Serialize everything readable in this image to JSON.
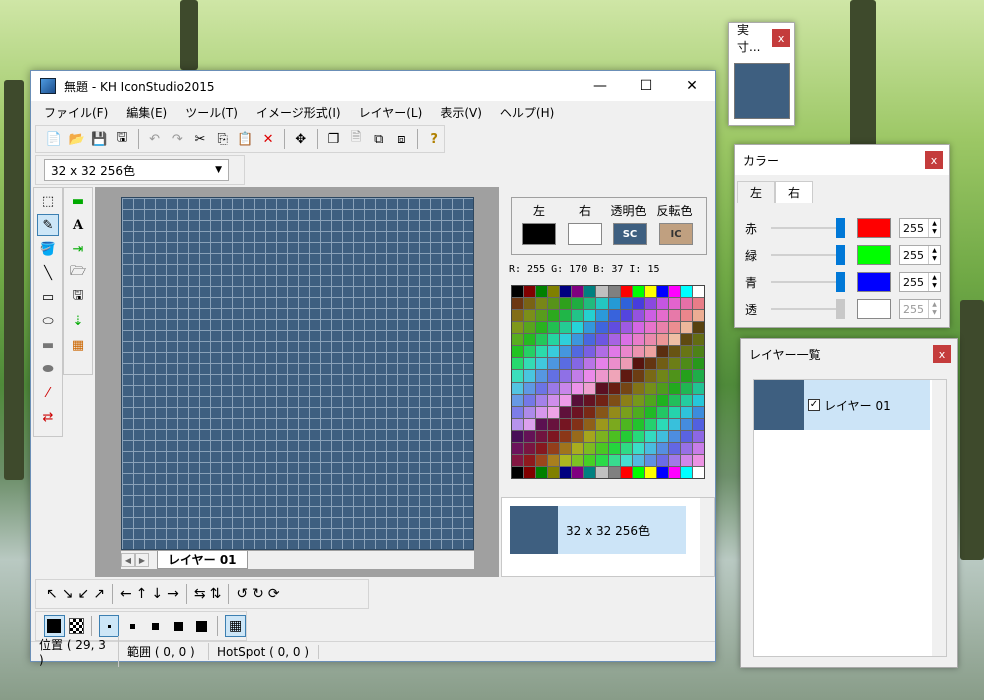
{
  "main_window": {
    "title": "無題 - KH IconStudio2015",
    "controls": {
      "minimize": "—",
      "maximize": "☐",
      "close": "✕"
    }
  },
  "menu": [
    "ファイル(F)",
    "編集(E)",
    "ツール(T)",
    "イメージ形式(I)",
    "レイヤー(L)",
    "表示(V)",
    "ヘルプ(H)"
  ],
  "size_select": {
    "value": "32 x 32 256色"
  },
  "color_box": {
    "left_label": "左",
    "right_label": "右",
    "transparent_label": "透明色",
    "invert_label": "反転色",
    "transparent_code": "SC",
    "invert_code": "IC",
    "left_color": "#000000",
    "right_color": "#ffffff",
    "transparent_color": "#3e5f80",
    "invert_color": "#c0a080"
  },
  "rgb_readout": "R: 255 G: 170 B:  37 I:  15",
  "icon_list": {
    "item_label": "32 x 32 256色"
  },
  "layer_tab": {
    "label": "レイヤー 01"
  },
  "status": {
    "position": "位置 ( 29, 3 )",
    "range": "範囲 ( 0, 0 )",
    "hotspot": "HotSpot ( 0, 0 )"
  },
  "actual_window": {
    "title": "実寸...",
    "close": "x"
  },
  "color_window": {
    "title": "カラー",
    "close": "x",
    "tab_left": "左",
    "tab_right": "右",
    "rows": [
      {
        "label": "赤",
        "value": "255",
        "color": "#ff0000"
      },
      {
        "label": "緑",
        "value": "255",
        "color": "#00ff00"
      },
      {
        "label": "青",
        "value": "255",
        "color": "#0000ff"
      },
      {
        "label": "透",
        "value": "255",
        "color": "#ffffff"
      }
    ]
  },
  "layer_window": {
    "title": "レイヤー一覧",
    "close": "x",
    "layer_name": "レイヤー 01"
  }
}
